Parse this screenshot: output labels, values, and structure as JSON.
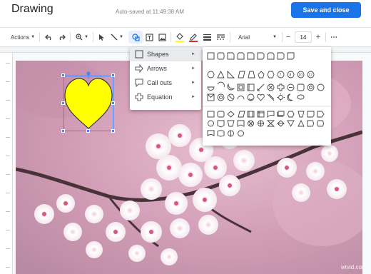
{
  "header": {
    "title": "Drawing",
    "autosave": "Auto-saved at 11:49:38 AM",
    "save_button": "Save and close"
  },
  "toolbar": {
    "actions_label": "Actions",
    "font_name": "Arial",
    "font_size": "14",
    "decrease_label": "−",
    "increase_label": "+",
    "more_label": "⋯"
  },
  "shape_menu": {
    "items": [
      {
        "label": "Shapes",
        "arrow": "►"
      },
      {
        "label": "Arrows",
        "arrow": "►"
      },
      {
        "label": "Call outs",
        "arrow": "►"
      },
      {
        "label": "Equation",
        "arrow": "►"
      }
    ]
  },
  "colors": {
    "accent": "#1a73e8",
    "heart_fill": "#ffff00",
    "selection": "#4285f4"
  },
  "watermark": "wtvid.com"
}
